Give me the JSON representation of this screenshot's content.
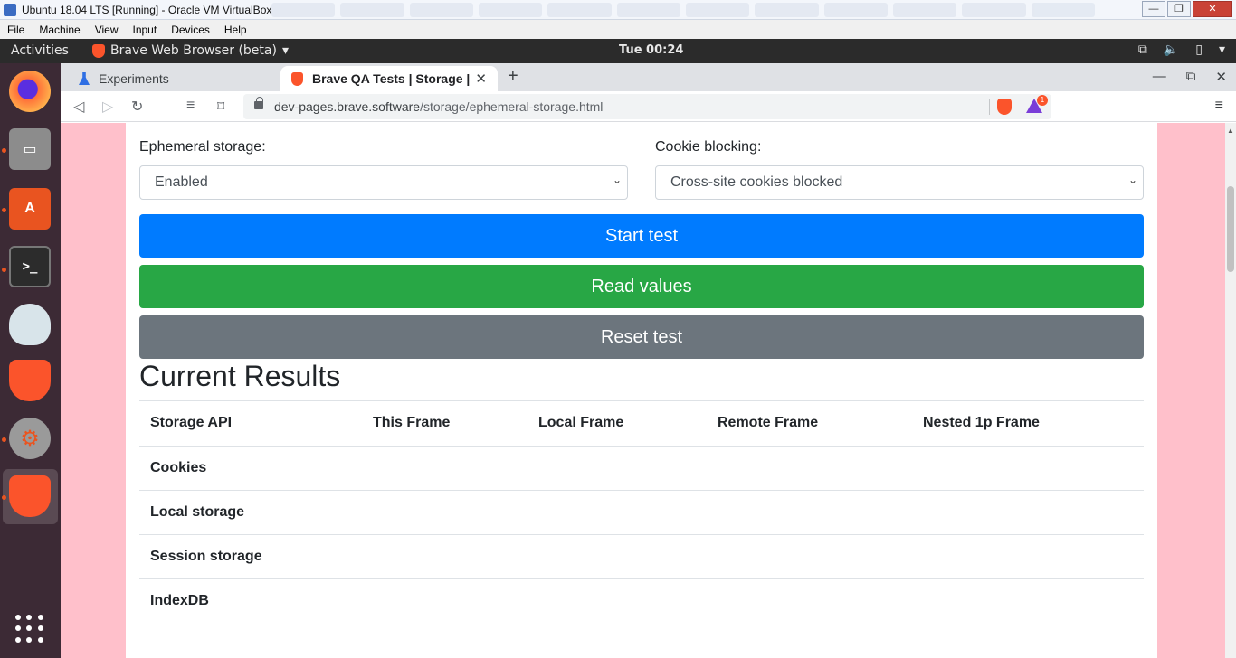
{
  "vbox": {
    "title": "Ubuntu 18.04 LTS [Running] - Oracle VM VirtualBox",
    "menu": [
      "File",
      "Machine",
      "View",
      "Input",
      "Devices",
      "Help"
    ]
  },
  "ubuntu": {
    "activities": "Activities",
    "app_menu": "Brave Web Browser (beta)",
    "clock": "Tue 00:24"
  },
  "browser": {
    "tabs": [
      {
        "title": "Experiments",
        "icon": "flask-icon",
        "active": false
      },
      {
        "title": "Brave QA Tests | Storage |",
        "icon": "brave-icon",
        "active": true
      }
    ],
    "url_host": "dev-pages.brave.software",
    "url_path": "/storage/ephemeral-storage.html",
    "rewards_badge": "1"
  },
  "page": {
    "ephemeral_label": "Ephemeral storage:",
    "ephemeral_value": "Enabled",
    "cookie_label": "Cookie blocking:",
    "cookie_value": "Cross-site cookies blocked",
    "start_label": "Start test",
    "read_label": "Read values",
    "reset_label": "Reset test",
    "results_title": "Current Results",
    "table_headers": [
      "Storage API",
      "This Frame",
      "Local Frame",
      "Remote Frame",
      "Nested 1p Frame"
    ],
    "table_rows": [
      "Cookies",
      "Local storage",
      "Session storage",
      "IndexDB"
    ]
  },
  "colors": {
    "page_bg": "#ffc0cb",
    "primary": "#007bff",
    "success": "#28a745",
    "secondary": "#6c757d"
  }
}
